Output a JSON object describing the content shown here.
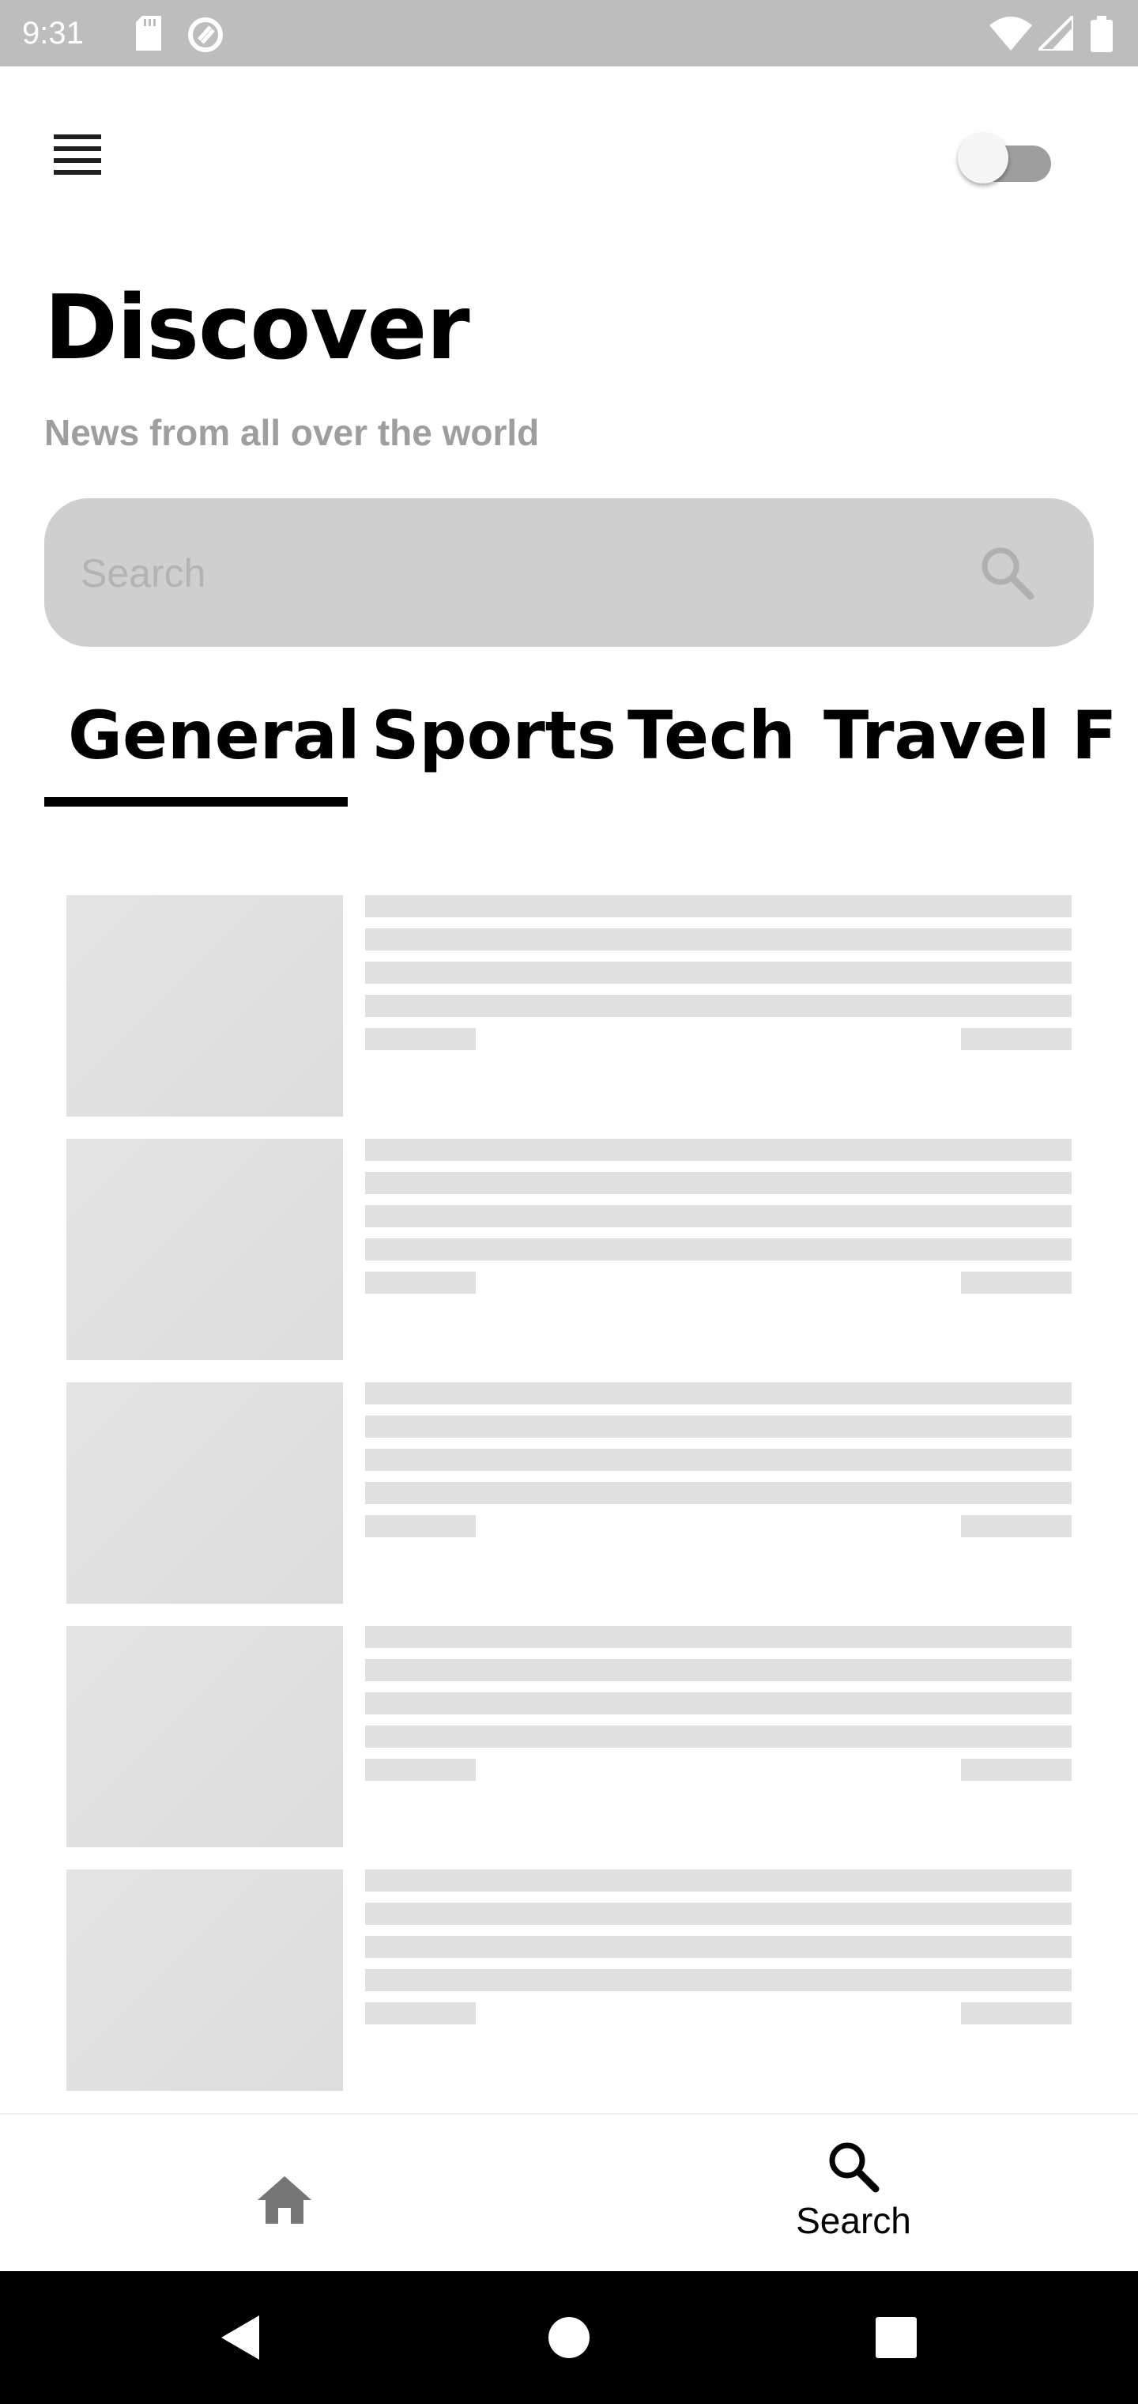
{
  "status_bar": {
    "time": "9:31",
    "icons": [
      "sd-card-icon",
      "do-not-disturb-icon",
      "wifi-icon",
      "signal-icon",
      "battery-icon"
    ]
  },
  "header": {
    "menu_icon": "menu-icon",
    "toggle_state": "off"
  },
  "page": {
    "title": "Discover",
    "subtitle": "News from all over the world"
  },
  "search": {
    "placeholder": "Search",
    "value": "",
    "icon": "search-icon"
  },
  "tabs": {
    "items": [
      {
        "label": "General",
        "selected": true
      },
      {
        "label": "Sports",
        "selected": false
      },
      {
        "label": "Tech",
        "selected": false
      },
      {
        "label": "Travel",
        "selected": false
      },
      {
        "label": "F",
        "selected": false
      }
    ]
  },
  "article_list": {
    "state": "loading-skeleton",
    "placeholder_count": 5
  },
  "bottom_nav": {
    "items": [
      {
        "icon": "home-icon",
        "label": ""
      },
      {
        "icon": "search-icon",
        "label": "Search"
      }
    ]
  },
  "system_nav": {
    "icons": [
      "back-icon",
      "home-circle-icon",
      "recents-icon"
    ]
  },
  "colors": {
    "status_bar": "#bdbdbd",
    "search_background": "#cfcfcf",
    "subtitle": "#9e9e9e",
    "skeleton": "#e0e0e0",
    "accent": "#000000"
  }
}
